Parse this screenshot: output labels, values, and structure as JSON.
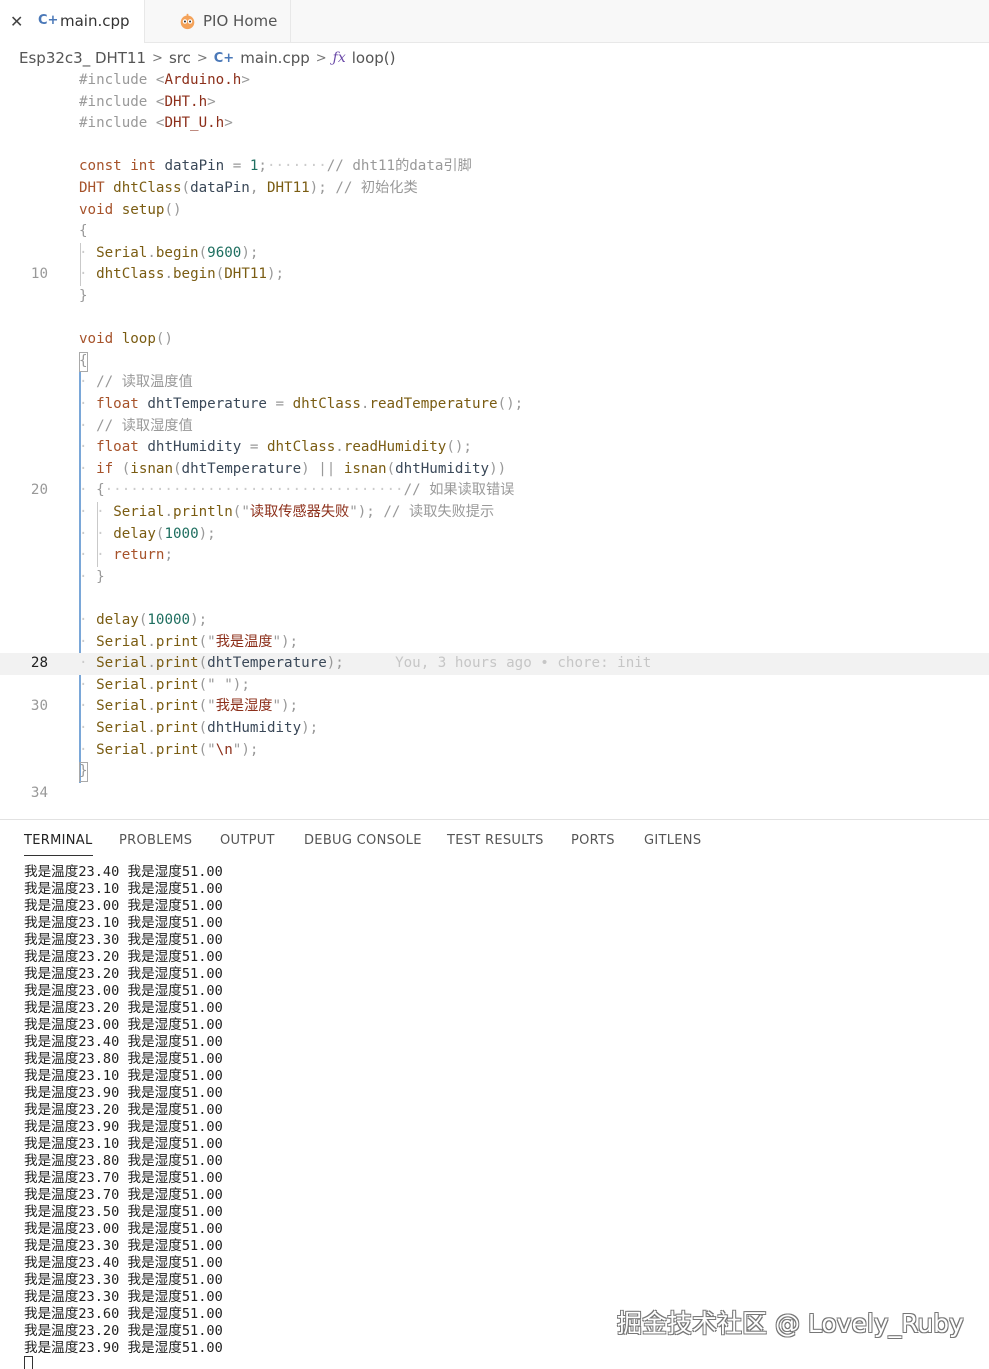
{
  "tabs": [
    {
      "label": "main.cpp",
      "active": true,
      "icon": "cpp-file-icon",
      "close_glyph": "✕",
      "icon_glyph": "C+"
    },
    {
      "label": "PIO Home",
      "active": false,
      "icon": "platformio-icon"
    }
  ],
  "breadcrumb": {
    "project": "Esp32c3_ DHT11",
    "folder": "src",
    "file": "main.cpp",
    "symbol_glyph": "ƒx",
    "symbol": "loop()",
    "separator": ">"
  },
  "editor": {
    "current_line": 28,
    "blame": "You, 3 hours ago • chore: init",
    "lines": [
      {
        "ln": "",
        "code": "#include <Arduino.h>"
      },
      {
        "ln": "",
        "code": "#include <DHT.h>"
      },
      {
        "ln": "",
        "code": "#include <DHT_U.h>"
      },
      {
        "ln": "",
        "code": ""
      },
      {
        "ln": "",
        "code": "const int dataPin = 1;       // dht11的data引脚"
      },
      {
        "ln": "",
        "code": "DHT dhtClass(dataPin, DHT11); // 初始化类"
      },
      {
        "ln": "",
        "code": "void setup()"
      },
      {
        "ln": "",
        "code": "{"
      },
      {
        "ln": "",
        "code": "  Serial.begin(9600);"
      },
      {
        "ln": "10",
        "code": "  dhtClass.begin(DHT11);"
      },
      {
        "ln": "",
        "code": "}"
      },
      {
        "ln": "",
        "code": ""
      },
      {
        "ln": "",
        "code": "void loop()"
      },
      {
        "ln": "",
        "code": "{"
      },
      {
        "ln": "",
        "code": "  // 读取温度值"
      },
      {
        "ln": "",
        "code": "  float dhtTemperature = dhtClass.readTemperature();"
      },
      {
        "ln": "",
        "code": "  // 读取湿度值"
      },
      {
        "ln": "",
        "code": "  float dhtHumidity = dhtClass.readHumidity();"
      },
      {
        "ln": "",
        "code": "  if (isnan(dhtTemperature) || isnan(dhtHumidity))"
      },
      {
        "ln": "20",
        "code": "  {                                   // 如果读取错误"
      },
      {
        "ln": "",
        "code": "    Serial.println(\"读取传感器失败\"); // 读取失败提示"
      },
      {
        "ln": "",
        "code": "    delay(1000);"
      },
      {
        "ln": "",
        "code": "    return;"
      },
      {
        "ln": "",
        "code": "  }"
      },
      {
        "ln": "",
        "code": ""
      },
      {
        "ln": "",
        "code": "  delay(10000);"
      },
      {
        "ln": "",
        "code": "  Serial.print(\"我是温度\");"
      },
      {
        "ln": "28",
        "code": "  Serial.print(dhtTemperature);"
      },
      {
        "ln": "",
        "code": "  Serial.print(\" \");"
      },
      {
        "ln": "30",
        "code": "  Serial.print(\"我是湿度\");"
      },
      {
        "ln": "",
        "code": "  Serial.print(dhtHumidity);"
      },
      {
        "ln": "",
        "code": "  Serial.print(\"\\n\");"
      },
      {
        "ln": "",
        "code": "}"
      },
      {
        "ln": "34",
        "code": ""
      }
    ]
  },
  "panel": {
    "tabs": [
      "TERMINAL",
      "PROBLEMS",
      "OUTPUT",
      "DEBUG CONSOLE",
      "TEST RESULTS",
      "PORTS",
      "GITLENS"
    ],
    "active_tab": "TERMINAL",
    "terminal_lines": [
      "我是温度23.40 我是湿度51.00",
      "我是温度23.10 我是湿度51.00",
      "我是温度23.00 我是湿度51.00",
      "我是温度23.10 我是湿度51.00",
      "我是温度23.30 我是湿度51.00",
      "我是温度23.20 我是湿度51.00",
      "我是温度23.20 我是湿度51.00",
      "我是温度23.00 我是湿度51.00",
      "我是温度23.20 我是湿度51.00",
      "我是温度23.00 我是湿度51.00",
      "我是温度23.40 我是湿度51.00",
      "我是温度23.80 我是湿度51.00",
      "我是温度23.10 我是湿度51.00",
      "我是温度23.90 我是湿度51.00",
      "我是温度23.20 我是湿度51.00",
      "我是温度23.90 我是湿度51.00",
      "我是温度23.10 我是湿度51.00",
      "我是温度23.80 我是湿度51.00",
      "我是温度23.70 我是湿度51.00",
      "我是温度23.70 我是湿度51.00",
      "我是温度23.50 我是湿度51.00",
      "我是温度23.00 我是湿度51.00",
      "我是温度23.30 我是湿度51.00",
      "我是温度23.40 我是湿度51.00",
      "我是温度23.30 我是湿度51.00",
      "我是温度23.30 我是湿度51.00",
      "我是温度23.60 我是湿度51.00",
      "我是温度23.20 我是湿度51.00",
      "我是温度23.90 我是湿度51.00"
    ]
  },
  "watermark": "掘金技术社区 @ Lovely_Ruby"
}
